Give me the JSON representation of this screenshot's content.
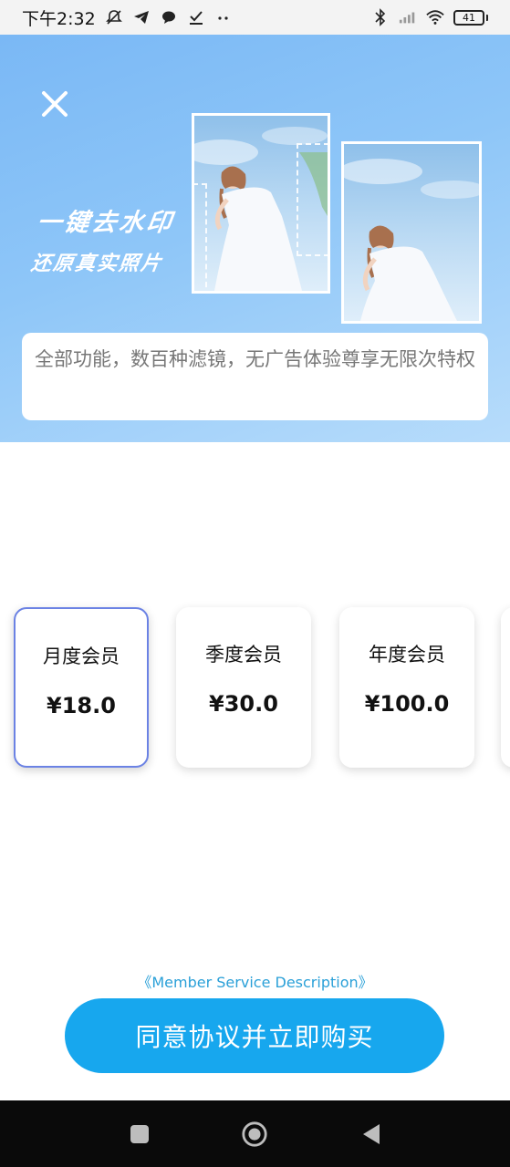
{
  "status_bar": {
    "time": "下午2:32",
    "battery": "41"
  },
  "banner": {
    "headline_1": "一键去水印",
    "headline_2": "还原真实照片",
    "description": "全部功能，数百种滤镜，无广告体验尊享无限次特权"
  },
  "plans": [
    {
      "name": "月度会员",
      "price": "¥18.0",
      "selected": true
    },
    {
      "name": "季度会员",
      "price": "¥30.0",
      "selected": false
    },
    {
      "name": "年度会员",
      "price": "¥100.0",
      "selected": false
    }
  ],
  "service_link": "《Member Service Description》",
  "buy_button": "同意协议并立即购买",
  "colors": {
    "accent": "#17a7ee",
    "selected_border": "#6b82e4",
    "link": "#2aa0d8"
  },
  "icons": [
    "notification-off-icon",
    "telegram-icon",
    "chat-icon",
    "check-icon",
    "more-icon",
    "bluetooth-icon",
    "signal-icon",
    "wifi-icon",
    "battery-icon",
    "close-icon",
    "recents-icon",
    "home-icon",
    "back-icon"
  ]
}
